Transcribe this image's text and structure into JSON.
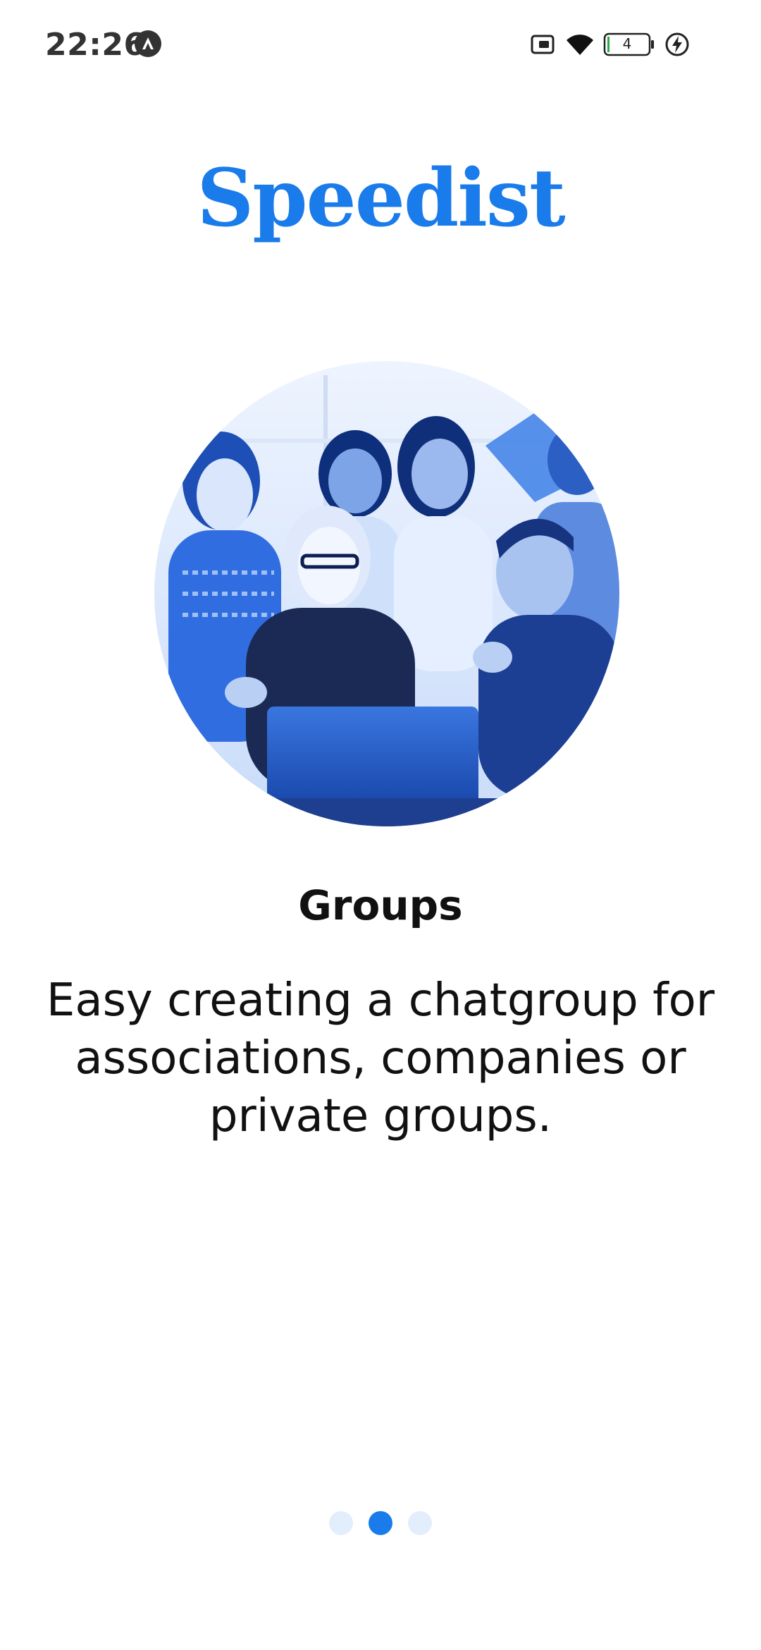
{
  "status_bar": {
    "time": "22:26",
    "battery_level": "4",
    "icons": [
      "app-notification-icon",
      "sim-card-icon",
      "wifi-icon",
      "battery-icon",
      "charging-icon"
    ]
  },
  "brand": {
    "logo_text": "Speedist",
    "accent_color": "#1a7bea"
  },
  "slide": {
    "image": "group-of-people-around-laptop",
    "title": "Groups",
    "description": "Easy creating a chatgroup for associations, companies or private groups."
  },
  "pager": {
    "total": 3,
    "active_index": 1,
    "active_color": "#1a7bea",
    "inactive_color": "#e3eefc"
  }
}
